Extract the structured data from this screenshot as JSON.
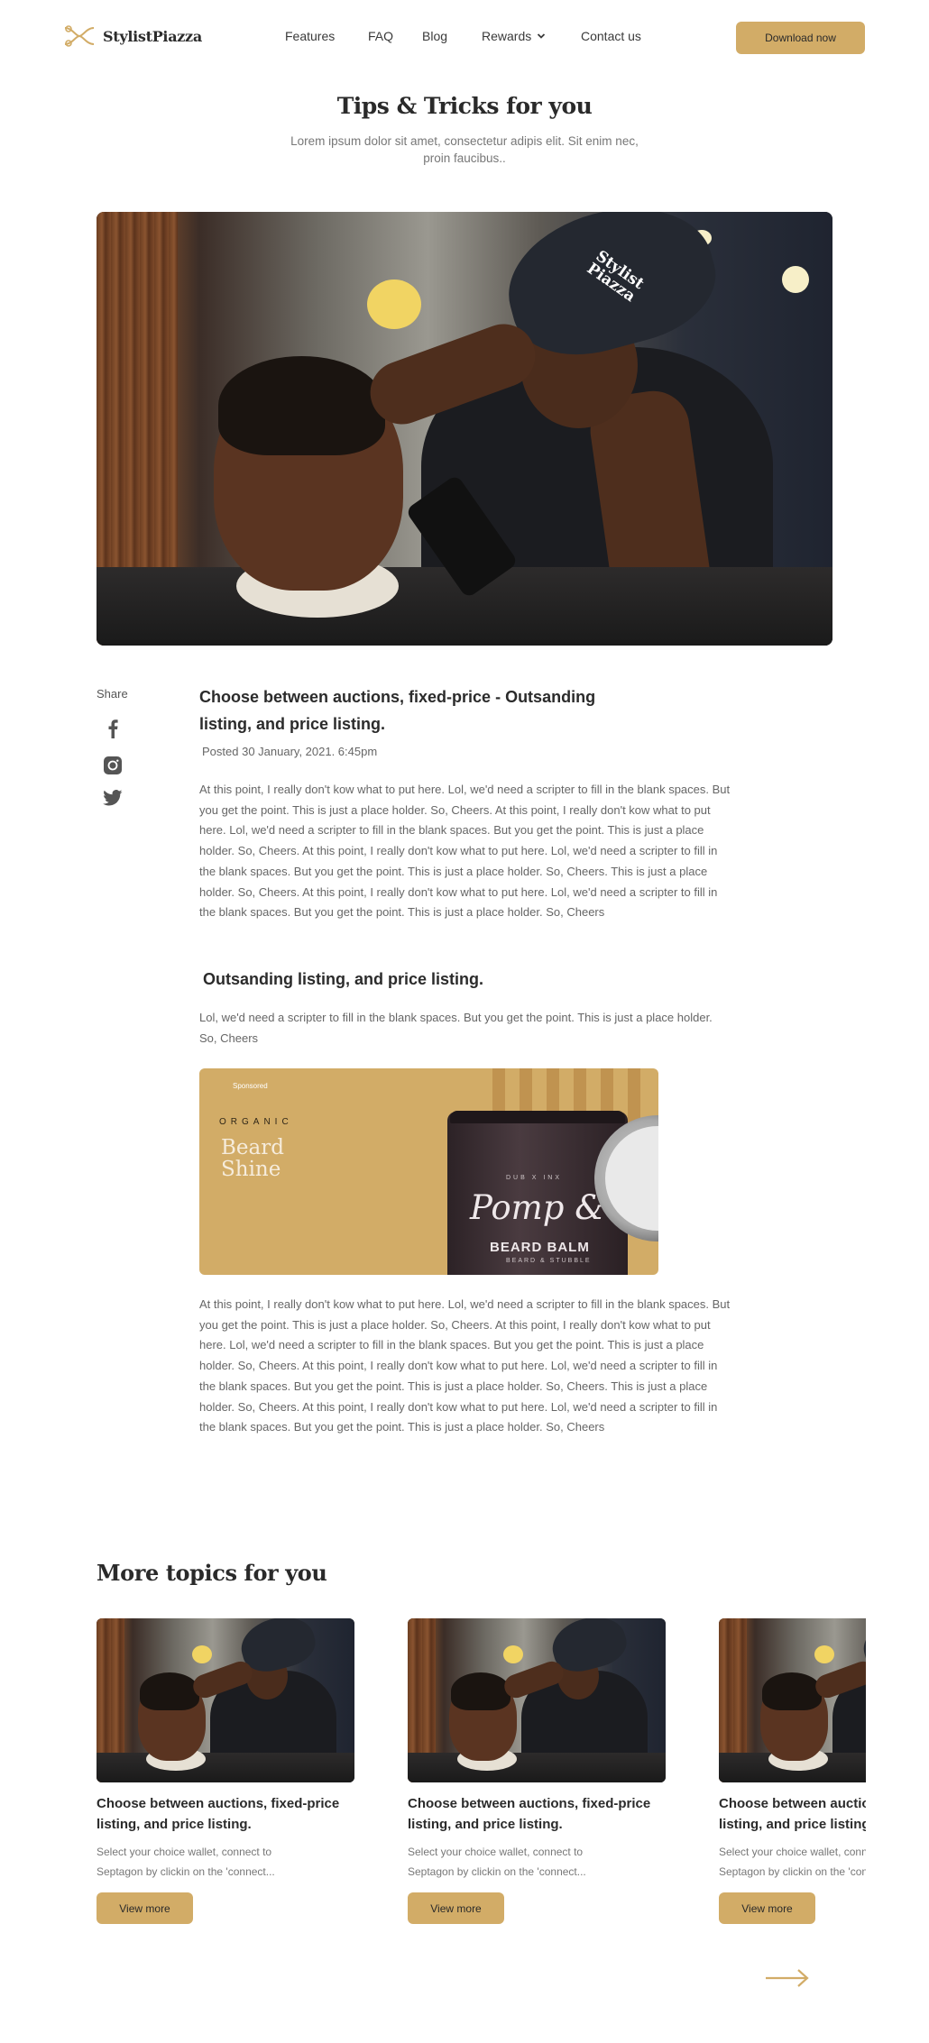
{
  "brand": {
    "name": "StylistPiazza",
    "accent_color": "#d2ac67",
    "logo_icon": "crossed-scissors-icon"
  },
  "nav": {
    "links": [
      "Features",
      "FAQ",
      "Blog",
      "Rewards",
      "Contact us"
    ],
    "rewards_icon": "chevron-down-icon",
    "download_label": "Download now"
  },
  "header": {
    "title": "Tips & Tricks for you",
    "subtitle": "Lorem ipsum dolor sit amet, consectetur adipis elit. Sit enim nec, proin faucibus.."
  },
  "hero_image": {
    "cap_text": "Stylist Piazza"
  },
  "share": {
    "label": "Share",
    "icons": [
      "facebook-icon",
      "instagram-icon",
      "twitter-icon"
    ]
  },
  "article": {
    "title": "Choose between auctions, fixed-price - Outsanding listing, and price listing.",
    "posted": "Posted 30 January, 2021. 6:45pm",
    "paragraph_1": "At this point, I really don't kow what to put here. Lol, we'd need a scripter to fill in the blank spaces. But you get the point. This is just a place holder. So, Cheers. At this point, I really don't kow what to put here. Lol, we'd need a scripter to fill in the blank spaces. But you get the point. This is just a place holder. So, Cheers. At this point, I really don't kow what to put here. Lol, we'd need a scripter to fill in the blank spaces. But you get the point. This is just a place holder. So, Cheers. This is just a place holder. So, Cheers. At this point, I really don't kow what to put here. Lol, we'd need a scripter to fill in the blank spaces. But you get the point. This is just a place holder. So, Cheers",
    "section_heading": "Outsanding listing, and price listing.",
    "paragraph_2": "Lol, we'd need a scripter to fill in the blank spaces. But you get the point. This is just a place holder. So, Cheers",
    "paragraph_3": "At this point, I really don't kow what to put here. Lol, we'd need a scripter to fill in the blank spaces. But you get the point. This is just a place holder. So, Cheers. At this point, I really don't kow what to put here. Lol, we'd need a scripter to fill in the blank spaces. But you get the point. This is just a place holder. So, Cheers. At this point, I really don't kow what to put here. Lol, we'd need a scripter to fill in the blank spaces. But you get the point. This is just a place holder. So, Cheers. This is just a place holder. So, Cheers. At this point, I really don't kow what to put here. Lol, we'd need a scripter to fill in the blank spaces. But you get the point. This is just a place holder. So, Cheers"
  },
  "ad": {
    "sponsored": "Sponsored",
    "eyebrow": "ORGANIC",
    "headline": "Beard Shine",
    "jar_brand_top": "DUB X INX",
    "jar_script": "Pomp &",
    "jar_name": "BEARD BALM",
    "jar_sub": "BEARD & STUBBLE"
  },
  "more_topics": {
    "title": "More topics for you",
    "cards": [
      {
        "title": "Choose between auctions, fixed-price listing, and price listing.",
        "desc": "Select your choice wallet, connect to Septagon by clickin on the 'connect...",
        "button": "View more"
      },
      {
        "title": "Choose between auctions, fixed-price listing, and price listing.",
        "desc": "Select your choice wallet, connect to Septagon by clickin on the 'connect...",
        "button": "View more"
      },
      {
        "title": "Choose between auctions, fixed-price listing, and price listing.",
        "desc": "Select your choice wallet, connect to Septagon by clickin on the 'connect...",
        "button": "View more"
      }
    ],
    "next_icon": "arrow-right-icon"
  }
}
